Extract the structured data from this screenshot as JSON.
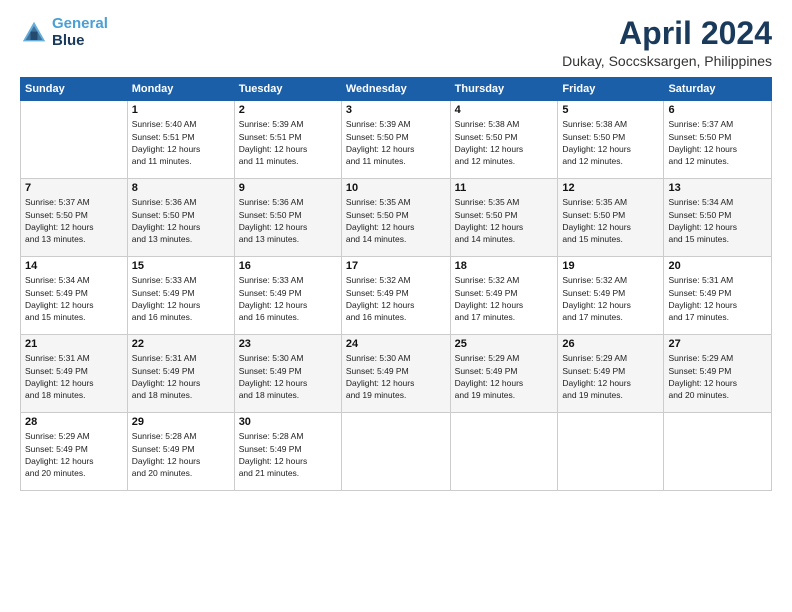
{
  "header": {
    "logo_line1": "General",
    "logo_line2": "Blue",
    "month": "April 2024",
    "location": "Dukay, Soccsksargen, Philippines"
  },
  "weekdays": [
    "Sunday",
    "Monday",
    "Tuesday",
    "Wednesday",
    "Thursday",
    "Friday",
    "Saturday"
  ],
  "weeks": [
    [
      {
        "day": "",
        "info": ""
      },
      {
        "day": "1",
        "info": "Sunrise: 5:40 AM\nSunset: 5:51 PM\nDaylight: 12 hours\nand 11 minutes."
      },
      {
        "day": "2",
        "info": "Sunrise: 5:39 AM\nSunset: 5:51 PM\nDaylight: 12 hours\nand 11 minutes."
      },
      {
        "day": "3",
        "info": "Sunrise: 5:39 AM\nSunset: 5:50 PM\nDaylight: 12 hours\nand 11 minutes."
      },
      {
        "day": "4",
        "info": "Sunrise: 5:38 AM\nSunset: 5:50 PM\nDaylight: 12 hours\nand 12 minutes."
      },
      {
        "day": "5",
        "info": "Sunrise: 5:38 AM\nSunset: 5:50 PM\nDaylight: 12 hours\nand 12 minutes."
      },
      {
        "day": "6",
        "info": "Sunrise: 5:37 AM\nSunset: 5:50 PM\nDaylight: 12 hours\nand 12 minutes."
      }
    ],
    [
      {
        "day": "7",
        "info": "Sunrise: 5:37 AM\nSunset: 5:50 PM\nDaylight: 12 hours\nand 13 minutes."
      },
      {
        "day": "8",
        "info": "Sunrise: 5:36 AM\nSunset: 5:50 PM\nDaylight: 12 hours\nand 13 minutes."
      },
      {
        "day": "9",
        "info": "Sunrise: 5:36 AM\nSunset: 5:50 PM\nDaylight: 12 hours\nand 13 minutes."
      },
      {
        "day": "10",
        "info": "Sunrise: 5:35 AM\nSunset: 5:50 PM\nDaylight: 12 hours\nand 14 minutes."
      },
      {
        "day": "11",
        "info": "Sunrise: 5:35 AM\nSunset: 5:50 PM\nDaylight: 12 hours\nand 14 minutes."
      },
      {
        "day": "12",
        "info": "Sunrise: 5:35 AM\nSunset: 5:50 PM\nDaylight: 12 hours\nand 15 minutes."
      },
      {
        "day": "13",
        "info": "Sunrise: 5:34 AM\nSunset: 5:50 PM\nDaylight: 12 hours\nand 15 minutes."
      }
    ],
    [
      {
        "day": "14",
        "info": "Sunrise: 5:34 AM\nSunset: 5:49 PM\nDaylight: 12 hours\nand 15 minutes."
      },
      {
        "day": "15",
        "info": "Sunrise: 5:33 AM\nSunset: 5:49 PM\nDaylight: 12 hours\nand 16 minutes."
      },
      {
        "day": "16",
        "info": "Sunrise: 5:33 AM\nSunset: 5:49 PM\nDaylight: 12 hours\nand 16 minutes."
      },
      {
        "day": "17",
        "info": "Sunrise: 5:32 AM\nSunset: 5:49 PM\nDaylight: 12 hours\nand 16 minutes."
      },
      {
        "day": "18",
        "info": "Sunrise: 5:32 AM\nSunset: 5:49 PM\nDaylight: 12 hours\nand 17 minutes."
      },
      {
        "day": "19",
        "info": "Sunrise: 5:32 AM\nSunset: 5:49 PM\nDaylight: 12 hours\nand 17 minutes."
      },
      {
        "day": "20",
        "info": "Sunrise: 5:31 AM\nSunset: 5:49 PM\nDaylight: 12 hours\nand 17 minutes."
      }
    ],
    [
      {
        "day": "21",
        "info": "Sunrise: 5:31 AM\nSunset: 5:49 PM\nDaylight: 12 hours\nand 18 minutes."
      },
      {
        "day": "22",
        "info": "Sunrise: 5:31 AM\nSunset: 5:49 PM\nDaylight: 12 hours\nand 18 minutes."
      },
      {
        "day": "23",
        "info": "Sunrise: 5:30 AM\nSunset: 5:49 PM\nDaylight: 12 hours\nand 18 minutes."
      },
      {
        "day": "24",
        "info": "Sunrise: 5:30 AM\nSunset: 5:49 PM\nDaylight: 12 hours\nand 19 minutes."
      },
      {
        "day": "25",
        "info": "Sunrise: 5:29 AM\nSunset: 5:49 PM\nDaylight: 12 hours\nand 19 minutes."
      },
      {
        "day": "26",
        "info": "Sunrise: 5:29 AM\nSunset: 5:49 PM\nDaylight: 12 hours\nand 19 minutes."
      },
      {
        "day": "27",
        "info": "Sunrise: 5:29 AM\nSunset: 5:49 PM\nDaylight: 12 hours\nand 20 minutes."
      }
    ],
    [
      {
        "day": "28",
        "info": "Sunrise: 5:29 AM\nSunset: 5:49 PM\nDaylight: 12 hours\nand 20 minutes."
      },
      {
        "day": "29",
        "info": "Sunrise: 5:28 AM\nSunset: 5:49 PM\nDaylight: 12 hours\nand 20 minutes."
      },
      {
        "day": "30",
        "info": "Sunrise: 5:28 AM\nSunset: 5:49 PM\nDaylight: 12 hours\nand 21 minutes."
      },
      {
        "day": "",
        "info": ""
      },
      {
        "day": "",
        "info": ""
      },
      {
        "day": "",
        "info": ""
      },
      {
        "day": "",
        "info": ""
      }
    ]
  ]
}
